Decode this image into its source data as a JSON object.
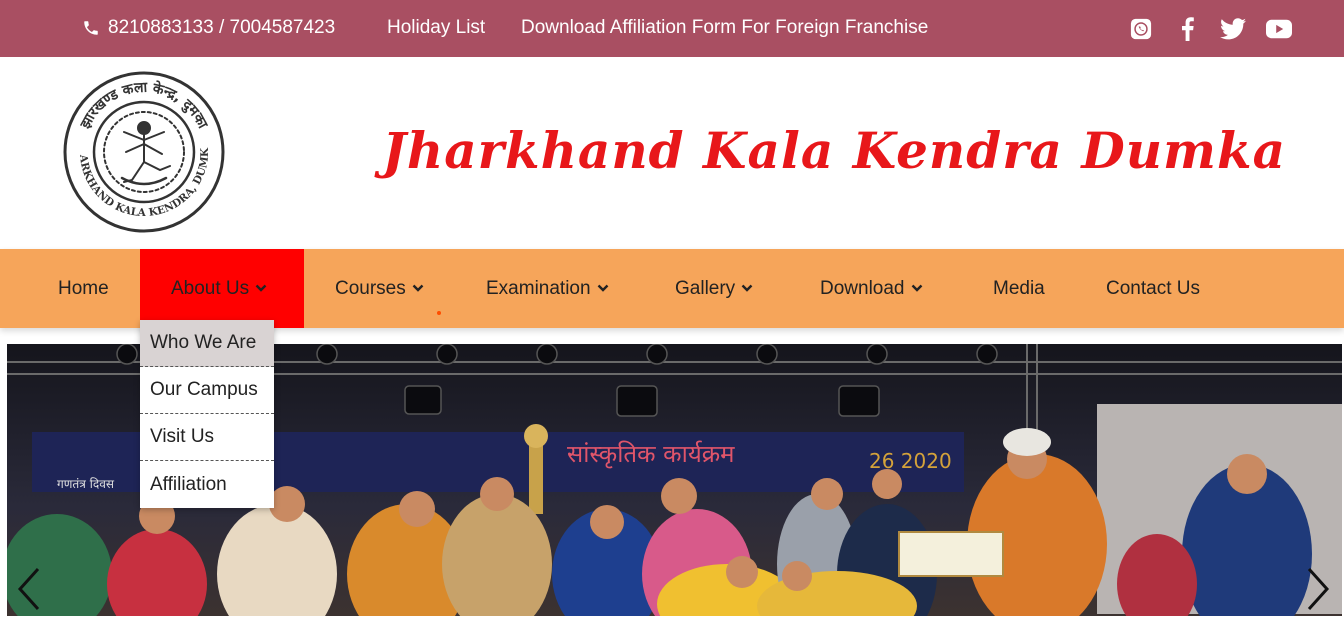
{
  "topbar": {
    "phone": "8210883133 / 7004587423",
    "holiday": "Holiday List",
    "affiliation": "Download Affiliation Form For Foreign Franchise",
    "social_icons": [
      "whatsapp-icon",
      "facebook-icon",
      "twitter-icon",
      "youtube-icon"
    ]
  },
  "header": {
    "brand": "Jharkhand Kala Kendra Dumka",
    "logo_text_top": "झारखण्ड कला केन्द्र, दुमका",
    "logo_text_bottom": "JHARKHAND KALA KENDRA, DUMKA"
  },
  "nav": {
    "items": [
      {
        "label": "Home"
      },
      {
        "label": "About Us"
      },
      {
        "label": "Courses"
      },
      {
        "label": "Examination"
      },
      {
        "label": "Gallery"
      },
      {
        "label": "Download"
      },
      {
        "label": "Media"
      },
      {
        "label": "Contact Us"
      }
    ]
  },
  "dropdown": {
    "items": [
      {
        "label": "Who We Are"
      },
      {
        "label": "Our Campus"
      },
      {
        "label": "Visit Us"
      },
      {
        "label": "Affiliation"
      }
    ]
  },
  "hero": {
    "banner_text": "सांस्कृतिक कार्यक्रम",
    "banner_year": "26 2020",
    "side_text": "गणतंत्र दिवस"
  },
  "colors": {
    "topbar": "#a94f62",
    "nav": "#f6a55a",
    "nav_active": "#ff0000",
    "brand": "#e8171a"
  }
}
